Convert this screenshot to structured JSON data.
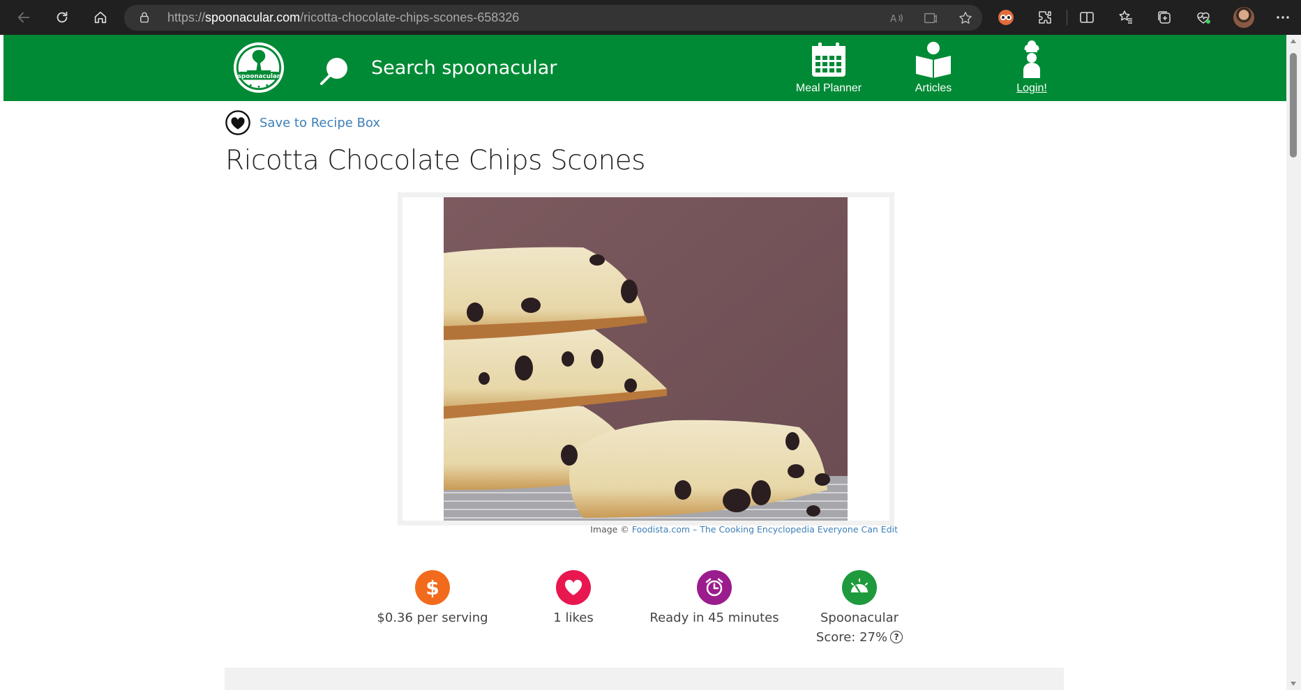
{
  "browser": {
    "url_host": "spoonacular.com",
    "url_path": "/ricotta-chocolate-chips-scones-658326",
    "url_scheme": "https://"
  },
  "header": {
    "logo_text": "spoonacular",
    "search_placeholder": "Search spoonacular",
    "nav": [
      {
        "label": "Meal Planner",
        "icon": "calendar-icon"
      },
      {
        "label": "Articles",
        "icon": "book-reader-icon"
      },
      {
        "label": "Login!",
        "icon": "chef-icon"
      }
    ]
  },
  "recipe": {
    "save_label": "Save to Recipe Box",
    "title": "Ricotta Chocolate Chips Scones",
    "image_alt": "Ricotta chocolate chip scones stacked",
    "credit_prefix": "Image © ",
    "credit_link": "Foodista.com – The Cooking Encyclopedia Everyone Can Edit",
    "stats": [
      {
        "label": "$0.36 per serving",
        "icon": "dollar-icon",
        "color": "#f26b1d"
      },
      {
        "label": "1 likes",
        "icon": "heart-icon",
        "color": "#e8174f"
      },
      {
        "label": "Ready in 45 minutes",
        "icon": "alarm-clock-icon",
        "color": "#9b1c8c"
      },
      {
        "label_line1": "Spoonacular",
        "label_line2": "Score: 27%",
        "icon": "gauge-icon",
        "help": "?",
        "color": "#1e9a3c"
      }
    ]
  },
  "colors": {
    "brand_green": "#008a35",
    "link_blue": "#3d7fb8"
  }
}
